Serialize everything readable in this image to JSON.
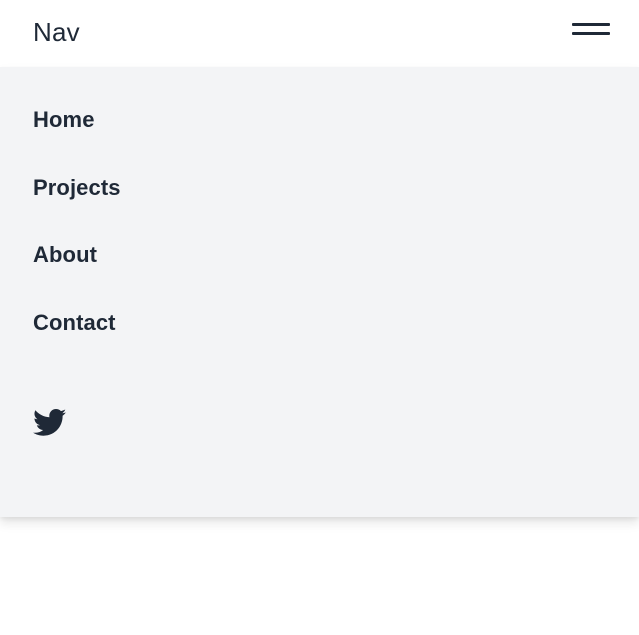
{
  "header": {
    "brand": "Nav",
    "menu_toggle_icon": "hamburger-menu-icon"
  },
  "drawer": {
    "items": [
      {
        "label": "Home"
      },
      {
        "label": "Projects"
      },
      {
        "label": "About"
      },
      {
        "label": "Contact"
      }
    ],
    "social": {
      "icon": "twitter-icon"
    }
  },
  "colors": {
    "text": "#1f2937",
    "drawer_bg": "#f3f4f6",
    "page_bg": "#ffffff"
  }
}
